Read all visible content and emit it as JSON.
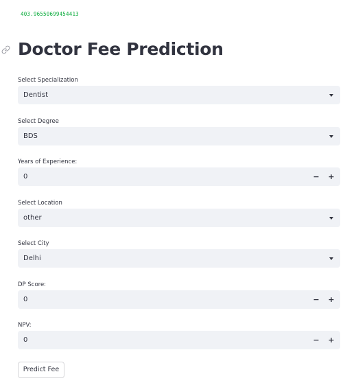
{
  "debug_output": "403.96550699454413",
  "page": {
    "title": "Doctor Fee Prediction"
  },
  "fields": {
    "specialization": {
      "label": "Select Specialization",
      "value": "Dentist"
    },
    "degree": {
      "label": "Select Degree",
      "value": "BDS"
    },
    "experience": {
      "label": "Years of Experience:",
      "value": "0",
      "minus": "−",
      "plus": "+"
    },
    "location": {
      "label": "Select Location",
      "value": "other"
    },
    "city": {
      "label": "Select City",
      "value": "Delhi"
    },
    "dp_score": {
      "label": "DP Score:",
      "value": "0",
      "minus": "−",
      "plus": "+"
    },
    "npv": {
      "label": "NPV:",
      "value": "0",
      "minus": "−",
      "plus": "+"
    }
  },
  "actions": {
    "predict_label": "Predict Fee"
  },
  "icons": {
    "title_anchor": "link-icon",
    "select_caret": "chevron-down-icon"
  },
  "colors": {
    "debug_text": "#09ab3b",
    "input_background": "#f0f2f6",
    "text": "#31333f",
    "button_border": "#d6d6d9"
  }
}
